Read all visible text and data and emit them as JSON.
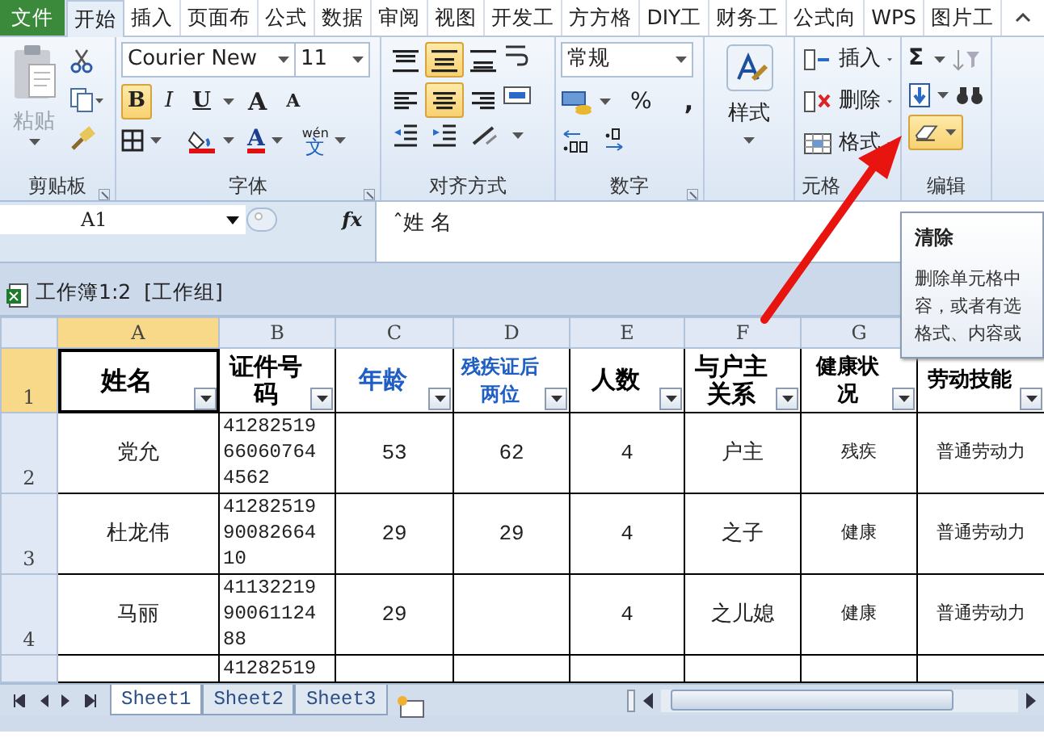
{
  "ribbon_tabs": [
    {
      "label": "文件",
      "kind": "file",
      "selected": false
    },
    {
      "label": "开始",
      "kind": "tab",
      "selected": true
    },
    {
      "label": "插入",
      "kind": "tab",
      "selected": false
    },
    {
      "label": "页面布",
      "kind": "tab",
      "selected": false
    },
    {
      "label": "公式",
      "kind": "tab",
      "selected": false
    },
    {
      "label": "数据",
      "kind": "tab",
      "selected": false
    },
    {
      "label": "审阅",
      "kind": "tab",
      "selected": false
    },
    {
      "label": "视图",
      "kind": "tab",
      "selected": false
    },
    {
      "label": "开发工",
      "kind": "tab",
      "selected": false
    },
    {
      "label": "方方格",
      "kind": "tab",
      "selected": false
    },
    {
      "label": "DIY工",
      "kind": "tab",
      "selected": false
    },
    {
      "label": "财务工",
      "kind": "tab",
      "selected": false
    },
    {
      "label": "公式向",
      "kind": "tab",
      "selected": false
    },
    {
      "label": "WPS",
      "kind": "tab",
      "selected": false
    },
    {
      "label": "图片工",
      "kind": "tab",
      "selected": false
    }
  ],
  "ribbon": {
    "clipboard": {
      "label": "剪贴板",
      "paste": "粘贴"
    },
    "font": {
      "label": "字体",
      "font_name": "Courier New",
      "font_size": "11",
      "styles": [
        {
          "kind": "bold",
          "text": "B",
          "on": true
        },
        {
          "kind": "italic",
          "text": "I",
          "on": false
        },
        {
          "kind": "underline",
          "text": "U",
          "on": false
        }
      ],
      "size_buttons": [
        {
          "kind": "grow",
          "text": "A"
        },
        {
          "kind": "shrink",
          "text": "A"
        }
      ],
      "font_color_text": "A",
      "phonetic_top": "wén",
      "phonetic_char": "文"
    },
    "alignment": {
      "label": "对齐方式",
      "buttons": [
        {
          "kind": "top",
          "on": false
        },
        {
          "kind": "middle",
          "on": true
        },
        {
          "kind": "bottom",
          "on": false
        },
        {
          "kind": "left",
          "on": false
        },
        {
          "kind": "center",
          "on": true
        },
        {
          "kind": "right",
          "on": false
        }
      ]
    },
    "number": {
      "label": "数字",
      "format": "常规",
      "symbols": [
        "%",
        ","
      ]
    },
    "styles": {
      "label": "样式"
    },
    "cells": {
      "label": "元格",
      "buttons": [
        "插入",
        "删除",
        "格式"
      ]
    },
    "editing": {
      "label": "编辑",
      "sum_symbol": "Σ",
      "clear_highlighted": true
    }
  },
  "formula_bar": {
    "name_box": "A1",
    "function_label": "fx",
    "content": "ˆ姓 名"
  },
  "workbook_title": "工作簿1:2  [工作组]",
  "tooltip": {
    "title": "清除",
    "lines": [
      "删除单元格中",
      "容，或者有选",
      "格式、内容或"
    ]
  },
  "sheet": {
    "columns": [
      {
        "label": "A",
        "selected": true
      },
      {
        "label": "B",
        "selected": false
      },
      {
        "label": "C",
        "selected": false
      },
      {
        "label": "D",
        "selected": false
      },
      {
        "label": "E",
        "selected": false
      },
      {
        "label": "F",
        "selected": false
      },
      {
        "label": "G",
        "selected": false
      }
    ],
    "header_row": {
      "label": "1",
      "selected": true,
      "cells": [
        {
          "text": "姓名",
          "color": "#000000"
        },
        {
          "text": "证件号码",
          "color": "#000000"
        },
        {
          "text": "年龄",
          "color": "#1f5fc4"
        },
        {
          "text": "残疾证后两位",
          "color": "#1f5fc4"
        },
        {
          "text": "人数",
          "color": "#000000"
        },
        {
          "text": "与户主关系",
          "color": "#000000"
        },
        {
          "text": "健康状况",
          "color": "#000000"
        },
        {
          "text": "劳动技能",
          "color": "#000000"
        }
      ]
    },
    "rows": [
      {
        "label": "2",
        "cells": [
          "党允",
          "41282519660607644562",
          "53",
          "62",
          "4",
          "户主",
          "残疾",
          "普通劳动力"
        ]
      },
      {
        "label": "3",
        "cells": [
          "杜龙伟",
          "412825199008266410",
          "29",
          "29",
          "4",
          "之子",
          "健康",
          "普通劳动力"
        ]
      },
      {
        "label": "4",
        "cells": [
          "马丽",
          "411322199006112488",
          "29",
          "",
          "4",
          "之儿媳",
          "健康",
          "普通劳动力"
        ]
      },
      {
        "cells": [
          "",
          "41282519",
          "",
          "",
          "",
          "",
          "",
          ""
        ]
      }
    ]
  },
  "sheet_tabs": [
    {
      "label": "Sheet1",
      "selected": true
    },
    {
      "label": "Sheet2",
      "selected": false
    },
    {
      "label": "Sheet3",
      "selected": false
    }
  ]
}
